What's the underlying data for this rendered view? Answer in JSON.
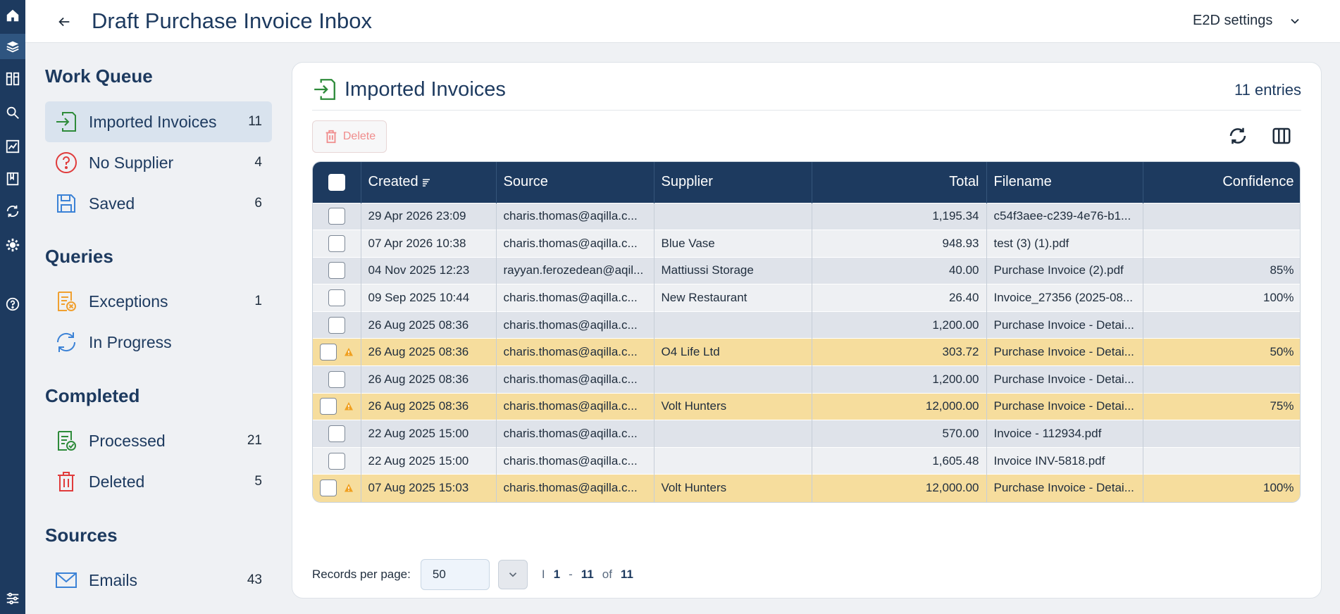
{
  "app": {
    "title": "Draft Purchase Invoice Inbox",
    "settings_label": "E2D settings"
  },
  "rail": [
    {
      "icon": "home-icon"
    },
    {
      "icon": "stack-icon"
    },
    {
      "icon": "columns-icon"
    },
    {
      "icon": "search-icon"
    },
    {
      "icon": "analytics-icon"
    },
    {
      "icon": "book-icon"
    },
    {
      "icon": "sync-icon"
    },
    {
      "icon": "gear-icon"
    },
    {
      "icon": "help-icon"
    },
    {
      "icon": "sliders-icon"
    }
  ],
  "sidebar": {
    "sections": [
      {
        "title": "Work Queue",
        "items": [
          {
            "label": "Imported Invoices",
            "count": "11",
            "icon": "import-icon",
            "active": true
          },
          {
            "label": "No Supplier",
            "count": "4",
            "icon": "question-icon"
          },
          {
            "label": "Saved",
            "count": "6",
            "icon": "save-icon"
          }
        ]
      },
      {
        "title": "Queries",
        "items": [
          {
            "label": "Exceptions",
            "count": "1",
            "icon": "exception-icon"
          },
          {
            "label": "In Progress",
            "count": "",
            "icon": "progress-icon"
          }
        ]
      },
      {
        "title": "Completed",
        "items": [
          {
            "label": "Processed",
            "count": "21",
            "icon": "processed-icon"
          },
          {
            "label": "Deleted",
            "count": "5",
            "icon": "trash-icon"
          }
        ]
      },
      {
        "title": "Sources",
        "items": [
          {
            "label": "Emails",
            "count": "43",
            "icon": "mail-icon"
          }
        ]
      }
    ]
  },
  "main": {
    "title": "Imported Invoices",
    "entries": "11 entries",
    "delete_label": "Delete",
    "columns": [
      "Created",
      "Source",
      "Supplier",
      "Total",
      "Filename",
      "Confidence"
    ],
    "rows": [
      {
        "created": "29 Apr 2026 23:09",
        "source": "charis.thomas@aqilla.c...",
        "supplier": "",
        "total": "1,195.34",
        "filename": "c54f3aee-c239-4e76-b1...",
        "confidence": "",
        "warn": false
      },
      {
        "created": "07 Apr 2026 10:38",
        "source": "charis.thomas@aqilla.c...",
        "supplier": "Blue Vase",
        "total": "948.93",
        "filename": "test (3) (1).pdf",
        "confidence": "",
        "warn": false
      },
      {
        "created": "04 Nov 2025 12:23",
        "source": "rayyan.ferozedean@aqil...",
        "supplier": "Mattiussi Storage",
        "total": "40.00",
        "filename": "Purchase Invoice (2).pdf",
        "confidence": "85%",
        "warn": false
      },
      {
        "created": "09 Sep 2025 10:44",
        "source": "charis.thomas@aqilla.c...",
        "supplier": "New Restaurant",
        "total": "26.40",
        "filename": "Invoice_27356 (2025-08...",
        "confidence": "100%",
        "warn": false
      },
      {
        "created": "26 Aug 2025 08:36",
        "source": "charis.thomas@aqilla.c...",
        "supplier": "",
        "total": "1,200.00",
        "filename": "Purchase Invoice - Detai...",
        "confidence": "",
        "warn": false
      },
      {
        "created": "26 Aug 2025 08:36",
        "source": "charis.thomas@aqilla.c...",
        "supplier": "O4 Life Ltd",
        "total": "303.72",
        "filename": "Purchase Invoice - Detai...",
        "confidence": "50%",
        "warn": true
      },
      {
        "created": "26 Aug 2025 08:36",
        "source": "charis.thomas@aqilla.c...",
        "supplier": "",
        "total": "1,200.00",
        "filename": "Purchase Invoice - Detai...",
        "confidence": "",
        "warn": false
      },
      {
        "created": "26 Aug 2025 08:36",
        "source": "charis.thomas@aqilla.c...",
        "supplier": "Volt Hunters",
        "total": "12,000.00",
        "filename": "Purchase Invoice - Detai...",
        "confidence": "75%",
        "warn": true
      },
      {
        "created": "22 Aug 2025 15:00",
        "source": "charis.thomas@aqilla.c...",
        "supplier": "",
        "total": "570.00",
        "filename": "Invoice - 112934.pdf",
        "confidence": "",
        "warn": false
      },
      {
        "created": "22 Aug 2025 15:00",
        "source": "charis.thomas@aqilla.c...",
        "supplier": "",
        "total": "1,605.48",
        "filename": "Invoice INV-5818.pdf",
        "confidence": "",
        "warn": false
      },
      {
        "created": "07 Aug 2025 15:03",
        "source": "charis.thomas@aqilla.c...",
        "supplier": "Volt Hunters",
        "total": "12,000.00",
        "filename": "Purchase Invoice - Detai...",
        "confidence": "100%",
        "warn": true
      }
    ],
    "footer": {
      "records_label": "Records per page:",
      "records_value": "50",
      "page_sep": "I",
      "range_start": "1",
      "dash": "-",
      "range_end": "11",
      "of": "of",
      "total": "11"
    }
  },
  "colors": {
    "navy": "#1d3a5f",
    "warn_row": "#f6dd9d",
    "accent_green": "#2e8b3a",
    "danger": "#e03b3b"
  }
}
